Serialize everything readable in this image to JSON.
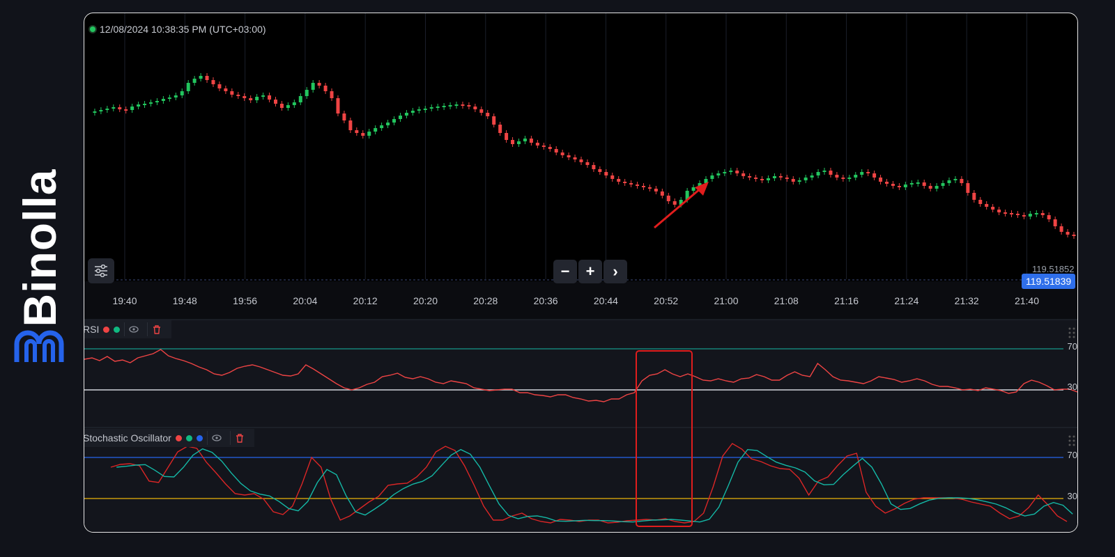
{
  "brand": {
    "name": "Binolla"
  },
  "header": {
    "datetime": "12/08/2024 10:38:35 PM (UTC+03:00)"
  },
  "price": {
    "top_label": "119.51852",
    "current": "119.51839"
  },
  "time_axis": [
    "19:40",
    "19:48",
    "19:56",
    "20:04",
    "20:12",
    "20:20",
    "20:28",
    "20:36",
    "20:44",
    "20:52",
    "21:00",
    "21:08",
    "21:16",
    "21:24",
    "21:32",
    "21:40"
  ],
  "rsi": {
    "label": "RSI",
    "levels": [
      "70",
      "30"
    ],
    "dots": [
      "#ef4444",
      "#10b981"
    ],
    "upper_color": "#14b8a6",
    "lower_color": "#d1d5db",
    "line_color": "#ef4444"
  },
  "stochastic": {
    "label": "Stochastic Oscillator",
    "levels": [
      "70",
      "30"
    ],
    "dots": [
      "#ef4444",
      "#10b981",
      "#2563eb"
    ],
    "upper_color": "#2563eb",
    "lower_color": "#eab308",
    "k_color": "#dc2626",
    "d_color": "#14b8a6"
  },
  "colors": {
    "up": "#22c55e",
    "down": "#ef4444",
    "annotation": "#e11d1d",
    "accent": "#2f6fea"
  },
  "icons": {
    "settings": "sliders-icon",
    "zoom_out": "minus-icon",
    "zoom_in": "plus-icon",
    "next": "chevron-right-icon",
    "visibility": "eye-icon",
    "delete": "trash-icon"
  },
  "zoom_controls": {
    "minus": "−",
    "plus": "+",
    "next": "›"
  }
}
